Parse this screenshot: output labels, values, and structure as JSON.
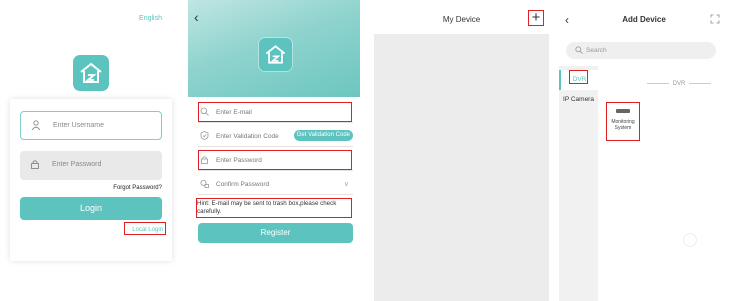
{
  "login": {
    "language": "English",
    "username_placeholder": "Enter Username",
    "password_placeholder": "Enter Password",
    "forgot_password": "Forgot Password?",
    "login_button": "Login",
    "local_login": "Local Login"
  },
  "register": {
    "email_placeholder": "Enter E-mail",
    "code_placeholder": "Enter Validation Code",
    "get_code_button": "Get Validation Code",
    "password_placeholder": "Enter Password",
    "confirm_placeholder": "Confirm Password",
    "hint": "Hint: E-mail may be sent to trash box,please check carefully.",
    "register_button": "Register"
  },
  "my_device": {
    "title": "My Device",
    "add_icon": "plus-icon"
  },
  "add_device": {
    "title": "Add Device",
    "search_placeholder": "Search",
    "categories": [
      "DVR",
      "IP Camera"
    ],
    "section_title": "DVR",
    "device_tile": "Monitoring System"
  },
  "colors": {
    "accent": "#5cc3bf",
    "highlight": "#e02020"
  }
}
